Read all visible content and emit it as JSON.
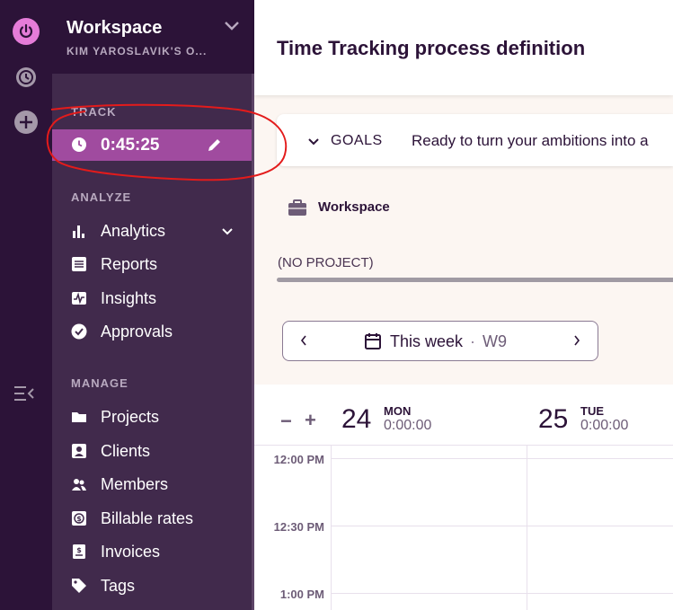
{
  "rail": {
    "icons": [
      "power-icon",
      "history-icon",
      "add-icon",
      "collapse-menu-icon"
    ],
    "accent": "#e57cd8"
  },
  "workspace": {
    "title": "Workspace",
    "subtitle": "KIM YAROSLAVIK'S O..."
  },
  "track": {
    "section": "TRACK",
    "time": "0:45:25"
  },
  "analyze": {
    "section": "ANALYZE",
    "items": [
      {
        "label": "Analytics",
        "icon": "bar-chart-icon"
      },
      {
        "label": "Reports",
        "icon": "report-icon"
      },
      {
        "label": "Insights",
        "icon": "insights-icon"
      },
      {
        "label": "Approvals",
        "icon": "check-circle-icon"
      }
    ]
  },
  "manage": {
    "section": "MANAGE",
    "items": [
      {
        "label": "Projects",
        "icon": "folder-icon"
      },
      {
        "label": "Clients",
        "icon": "client-icon"
      },
      {
        "label": "Members",
        "icon": "members-icon"
      },
      {
        "label": "Billable rates",
        "icon": "dollar-icon"
      },
      {
        "label": "Invoices",
        "icon": "invoice-icon"
      },
      {
        "label": "Tags",
        "icon": "tag-icon"
      }
    ]
  },
  "header": {
    "title": "Time Tracking process definition"
  },
  "goals": {
    "label": "GOALS",
    "text": "Ready to turn your ambitions into a"
  },
  "workspace_chip": "Workspace",
  "no_project": "(NO PROJECT)",
  "week_picker": {
    "label": "This week",
    "separator": "·",
    "week": "W9"
  },
  "calendar": {
    "zoom_out": "−",
    "zoom_in": "+",
    "days": [
      {
        "num": "24",
        "name": "MON",
        "total": "0:00:00"
      },
      {
        "num": "25",
        "name": "TUE",
        "total": "0:00:00"
      }
    ],
    "times": [
      "12:00 PM",
      "12:30 PM",
      "1:00 PM"
    ]
  },
  "colors": {
    "sidebar_dark": "#2c1338",
    "sidebar": "#412a4c",
    "track_active": "#a04b9f",
    "annotation": "#e31b1b"
  }
}
